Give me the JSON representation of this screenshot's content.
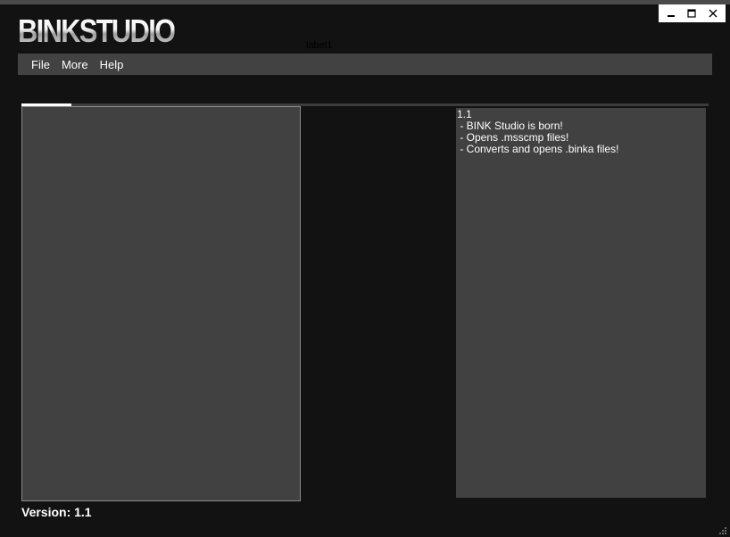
{
  "app": {
    "logo_text": "BINKSTUDIO",
    "label1": "label1"
  },
  "window_controls": {
    "minimize_icon": "minimize-icon",
    "maximize_icon": "maximize-icon",
    "close_icon": "close-icon"
  },
  "menu": {
    "items": [
      {
        "label": "File"
      },
      {
        "label": "More"
      },
      {
        "label": "Help"
      }
    ]
  },
  "changelog": {
    "lines": [
      "1.1",
      " - BINK Studio is born!",
      " - Opens .msscmp files!",
      " - Converts and opens .binka files!"
    ]
  },
  "footer": {
    "version_label": "Version: 1.1"
  },
  "colors": {
    "background": "#121212",
    "menu_bg": "#424242",
    "panel_bg": "#414141",
    "text": "#ffffff"
  }
}
